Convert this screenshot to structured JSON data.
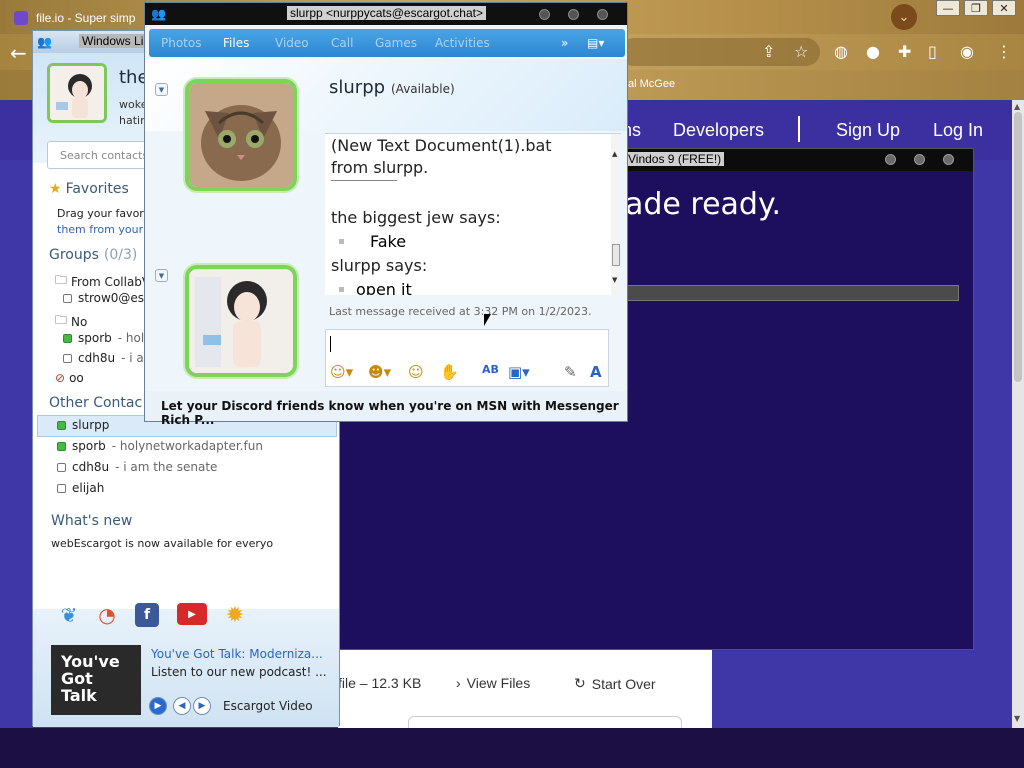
{
  "browser": {
    "tab_title": "file.io - Super simp",
    "bookmark": "al McGee"
  },
  "site": {
    "nav": [
      "ns",
      "Developers",
      "Sign Up",
      "Log In"
    ],
    "card": {
      "file_info": "file – 12.3 KB",
      "view_files": "View Files",
      "start_over": "Start Over"
    }
  },
  "w9": {
    "title": "Vindos 9 (FREE!)",
    "headline": "ade ready."
  },
  "wlm": {
    "title": "Windows Li",
    "name": "the",
    "psm_line1": "woke",
    "psm_line2": "hatin",
    "search_placeholder": "Search contacts",
    "favorites_label": "Favorites",
    "favorites_hint1": "Drag your favor",
    "favorites_hint2": "them from your",
    "groups_label": "Groups",
    "groups_count": "(0/3)",
    "groups": [
      {
        "name": "From CollabV"
      },
      {
        "name": "strow0@esc"
      },
      {
        "name": "No"
      }
    ],
    "group_contacts": [
      {
        "name": "sporb",
        "psm": " - holyn"
      },
      {
        "name": "cdh8u",
        "psm": " - i am"
      }
    ],
    "blocked_group": "oo",
    "other_label": "Other Contac",
    "other_contacts": [
      {
        "name": "slurpp",
        "psm": "",
        "online": true
      },
      {
        "name": "sporb",
        "psm": " - holynetworkadapter.fun",
        "online": true
      },
      {
        "name": "cdh8u",
        "psm": " - i am the senate",
        "online": false
      },
      {
        "name": "elijah",
        "psm": "",
        "online": false
      }
    ],
    "whats_new_label": "What's new",
    "whats_new_text": "webEscargot is now available for everyo",
    "news": {
      "thumb_text": "You've Got Talk",
      "title": "You've Got Talk: Moderniza...",
      "desc": "Listen to our new podcast! ...",
      "source": "Escargot Video"
    }
  },
  "chat": {
    "title": "slurpp <nurppycats@escargot.chat>",
    "tabs": [
      "Photos",
      "Files",
      "Video",
      "Call",
      "Games",
      "Activities"
    ],
    "active_tab": "Files",
    "contact_name": "slurpp",
    "contact_status": "(Available)",
    "history": {
      "file_line": "(New Text Document(1).bat",
      "from_line": "from slurpp.",
      "sender1": "the biggest jew says:",
      "msg1": "Fake",
      "sender2": "slurpp says:",
      "msg2": "open it"
    },
    "last_message": "Last message received at 3:32 PM on 1/2/2023.",
    "footer_ad": "Let your Discord friends know when you're on MSN with Messenger Rich P..."
  }
}
